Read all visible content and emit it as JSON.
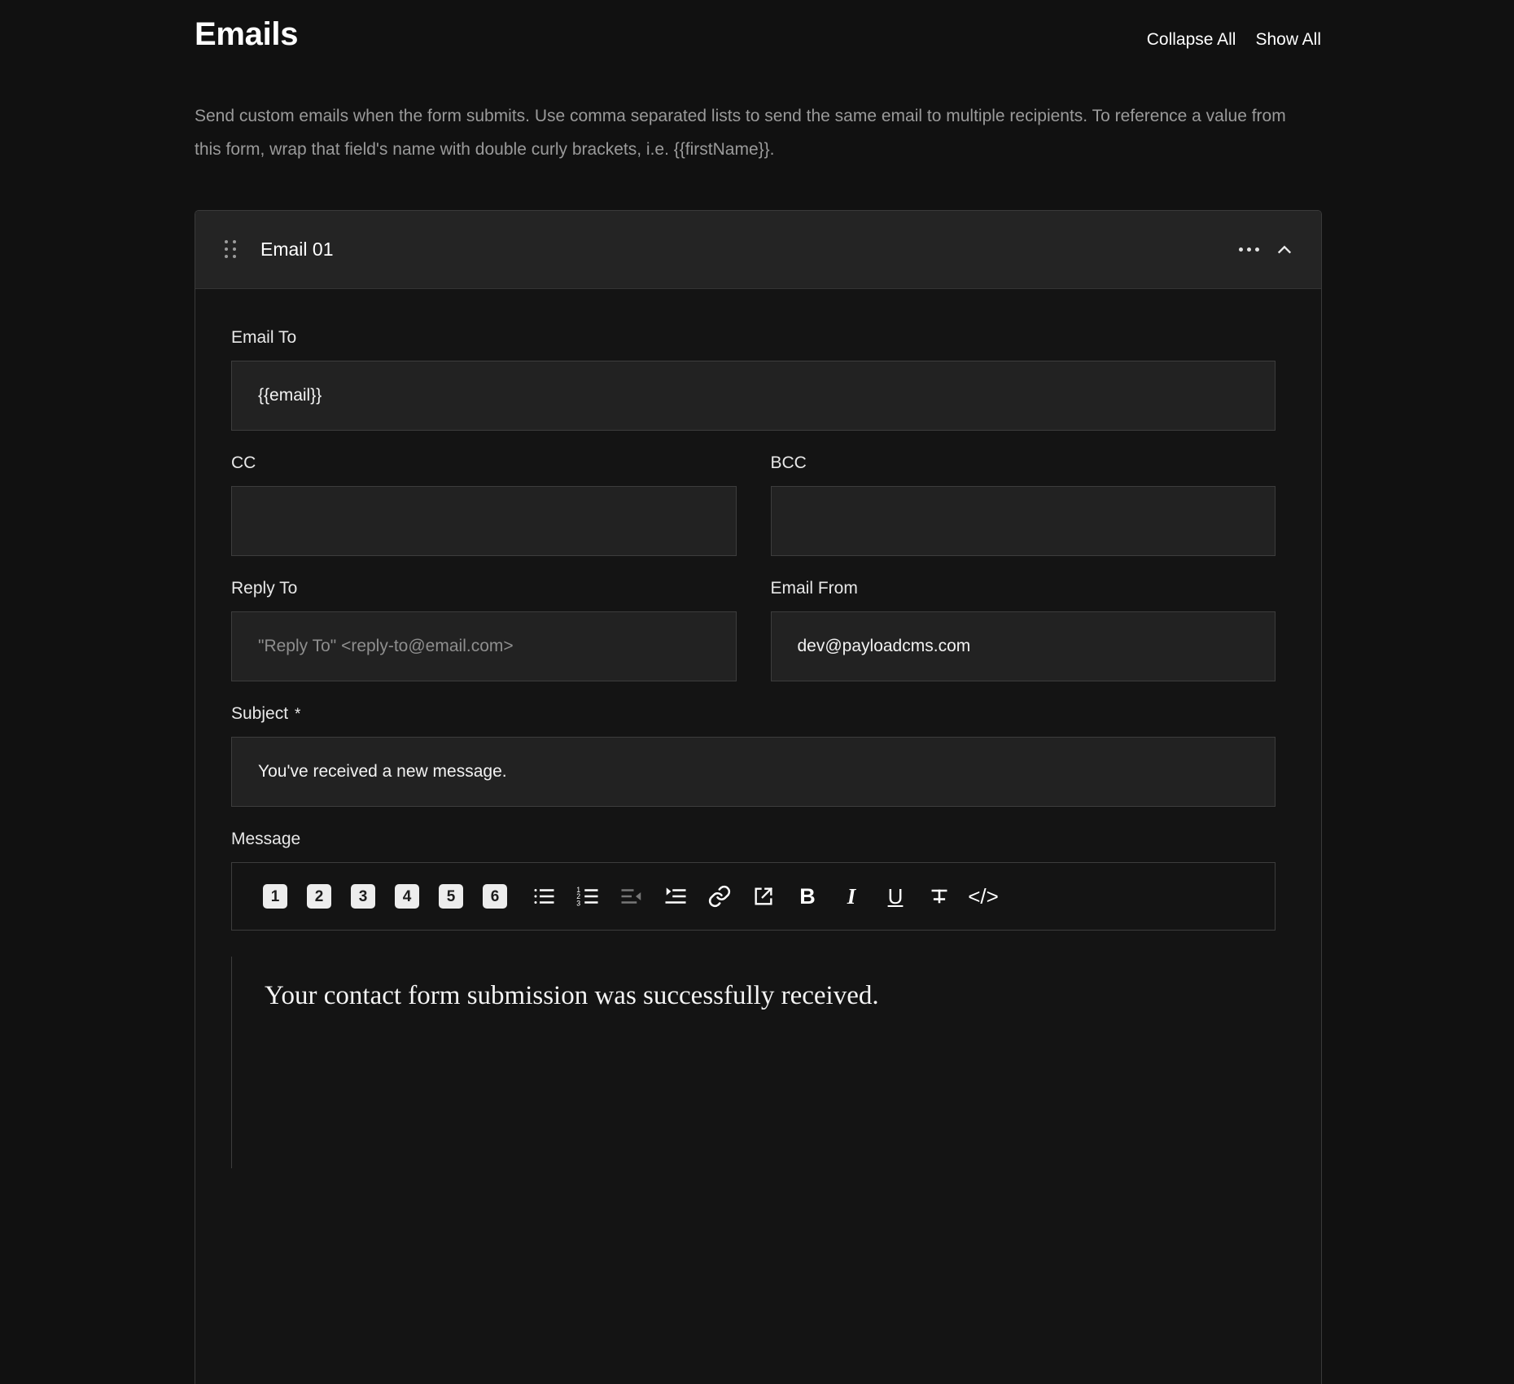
{
  "header": {
    "title": "Emails",
    "actions": [
      {
        "label": "Collapse All",
        "name": "collapse-all-button"
      },
      {
        "label": "Show All",
        "name": "show-all-button"
      }
    ],
    "description": "Send custom emails when the form submits. Use comma separated lists to send the same email to multiple recipients. To reference a value from this form, wrap that field's name with double curly brackets, i.e. {{firstName}}."
  },
  "card": {
    "title": "Email 01",
    "drag_handle_icon": "drag-handle-icon",
    "more_icon": "more-options-icon",
    "collapse_icon": "chevron-up-icon"
  },
  "fields": {
    "email_to": {
      "label": "Email To",
      "value": "{{email}}",
      "placeholder": ""
    },
    "cc": {
      "label": "CC",
      "value": "",
      "placeholder": ""
    },
    "bcc": {
      "label": "BCC",
      "value": "",
      "placeholder": ""
    },
    "reply_to": {
      "label": "Reply To",
      "value": "",
      "placeholder": "\"Reply To\" <reply-to@email.com>"
    },
    "email_from": {
      "label": "Email From",
      "value": "dev@payloadcms.com",
      "placeholder": ""
    },
    "subject": {
      "label": "Subject",
      "required_marker": "*",
      "value": "You've received a new message.",
      "placeholder": ""
    },
    "message": {
      "label": "Message",
      "body": "Your contact form submission was successfully received."
    }
  },
  "toolbar": {
    "headings": [
      {
        "label": "1",
        "name": "heading-1-button"
      },
      {
        "label": "2",
        "name": "heading-2-button"
      },
      {
        "label": "3",
        "name": "heading-3-button"
      },
      {
        "label": "4",
        "name": "heading-4-button"
      },
      {
        "label": "5",
        "name": "heading-5-button"
      },
      {
        "label": "6",
        "name": "heading-6-button"
      }
    ],
    "tools": [
      {
        "icon": "bullet-list-icon",
        "enabled": true
      },
      {
        "icon": "ordered-list-icon",
        "enabled": true
      },
      {
        "icon": "outdent-icon",
        "enabled": false
      },
      {
        "icon": "indent-icon",
        "enabled": true
      },
      {
        "icon": "link-icon",
        "enabled": true
      },
      {
        "icon": "external-link-icon",
        "enabled": true
      },
      {
        "icon": "bold-icon",
        "label": "B",
        "enabled": true
      },
      {
        "icon": "italic-icon",
        "label": "I",
        "enabled": true
      },
      {
        "icon": "underline-icon",
        "label": "U",
        "enabled": true
      },
      {
        "icon": "strikethrough-icon",
        "enabled": true
      },
      {
        "icon": "code-icon",
        "label": "</>",
        "enabled": true
      }
    ]
  },
  "colors": {
    "background": "#111111",
    "card_header": "#242424",
    "input_background": "#222222",
    "border": "#3d3d3d",
    "muted_text": "#9a9a9a",
    "text": "#ffffff"
  }
}
